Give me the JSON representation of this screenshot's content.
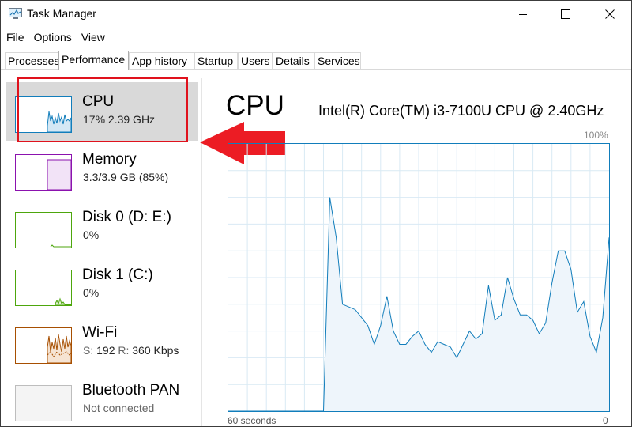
{
  "window": {
    "title": "Task Manager",
    "controls": {
      "minimize": "minimize",
      "maximize": "maximize",
      "close": "close"
    }
  },
  "menu": [
    "File",
    "Options",
    "View"
  ],
  "tabs": [
    {
      "label": "Processes",
      "active": false
    },
    {
      "label": "Performance",
      "active": true
    },
    {
      "label": "App history",
      "active": false
    },
    {
      "label": "Startup",
      "active": false
    },
    {
      "label": "Users",
      "active": false
    },
    {
      "label": "Details",
      "active": false
    },
    {
      "label": "Services",
      "active": false
    }
  ],
  "sidebar": {
    "items": [
      {
        "name": "CPU",
        "sub": "17%  2.39 GHz",
        "color": "#117dbb",
        "selected": true
      },
      {
        "name": "Memory",
        "sub": "3.3/3.9 GB (85%)",
        "color": "#8b12ae",
        "selected": false
      },
      {
        "name": "Disk 0 (D: E:)",
        "sub": "0%",
        "color": "#4da60c",
        "selected": false
      },
      {
        "name": "Disk 1 (C:)",
        "sub": "0%",
        "color": "#4da60c",
        "selected": false
      },
      {
        "name": "Wi-Fi",
        "sub_label_s": "S:",
        "sub_val_s": "192",
        "sub_label_r": "R:",
        "sub_val_r": "360 Kbps",
        "color": "#a74f01",
        "selected": false
      },
      {
        "name": "Bluetooth PAN",
        "sub": "Not connected",
        "color": "#999999",
        "selected": false
      }
    ]
  },
  "main": {
    "title": "CPU",
    "processor": "Intel(R) Core(TM) i3-7100U CPU @ 2.40GHz",
    "y_max_label": "100%",
    "time_left": "60 seconds",
    "time_right": "0"
  },
  "chart_data": {
    "type": "area",
    "x": [
      60,
      45,
      44,
      43,
      42,
      40,
      39,
      38,
      37,
      36,
      35,
      34,
      33,
      32,
      31,
      30,
      29,
      28,
      27,
      26,
      25,
      24,
      23,
      22,
      21,
      20,
      19,
      18,
      17,
      16,
      15,
      14,
      13,
      12,
      11,
      10,
      9,
      8,
      7,
      6,
      5,
      4,
      3,
      2,
      1,
      0
    ],
    "y": [
      0,
      0,
      80,
      65,
      40,
      38,
      35,
      32,
      25,
      32,
      43,
      30,
      25,
      25,
      28,
      30,
      25,
      22,
      26,
      25,
      24,
      20,
      25,
      30,
      27,
      29,
      47,
      34,
      36,
      50,
      42,
      36,
      36,
      34,
      29,
      33,
      48,
      60,
      60,
      53,
      37,
      41,
      28,
      22,
      35,
      65
    ],
    "ylim": [
      0,
      100
    ],
    "xlim": [
      60,
      0
    ],
    "grid": true,
    "color": "#117dbb"
  },
  "annotation": {
    "highlight_color": "#e0121d"
  }
}
